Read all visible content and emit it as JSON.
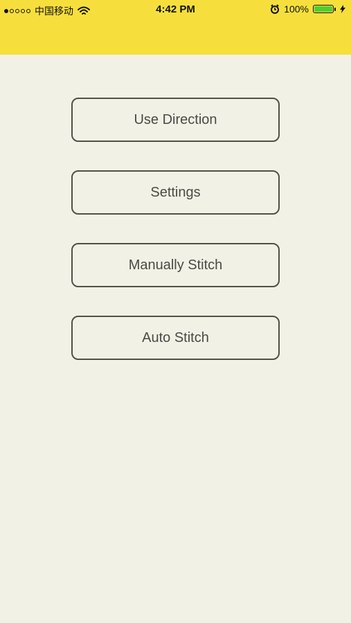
{
  "status_bar": {
    "carrier": "中国移动",
    "time": "4:42 PM",
    "battery_percent": "100%",
    "signal_strength": 1,
    "battery_level": 1.0,
    "battery_color": "#52cc3a"
  },
  "header": {
    "background_color": "#f6df3d"
  },
  "menu": {
    "buttons": [
      {
        "label": "Use Direction"
      },
      {
        "label": "Settings"
      },
      {
        "label": "Manually Stitch"
      },
      {
        "label": "Auto Stitch"
      }
    ]
  },
  "colors": {
    "page_background": "#f2f1e6",
    "button_border": "#505048",
    "button_text": "#4a4a44"
  }
}
